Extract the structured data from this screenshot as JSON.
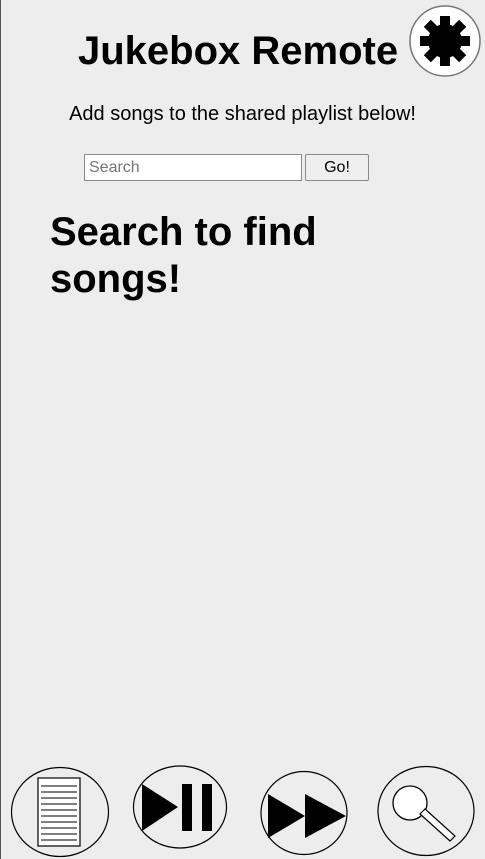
{
  "header": {
    "title": "Jukebox Remote",
    "settings_icon": "gear-icon"
  },
  "intro": {
    "subtitle": "Add songs to the shared playlist below!"
  },
  "search": {
    "placeholder": "Search",
    "value": "",
    "go_label": "Go!"
  },
  "results": {
    "empty_message": "Search to find songs!"
  },
  "bottom_nav": {
    "items": [
      {
        "id": "playlist",
        "icon": "playlist-icon"
      },
      {
        "id": "play-pause",
        "icon": "play-pause-icon"
      },
      {
        "id": "skip",
        "icon": "fast-forward-icon"
      },
      {
        "id": "search",
        "icon": "magnifier-icon"
      }
    ]
  },
  "colors": {
    "background": "#ededed",
    "icon_stroke": "#000000"
  }
}
